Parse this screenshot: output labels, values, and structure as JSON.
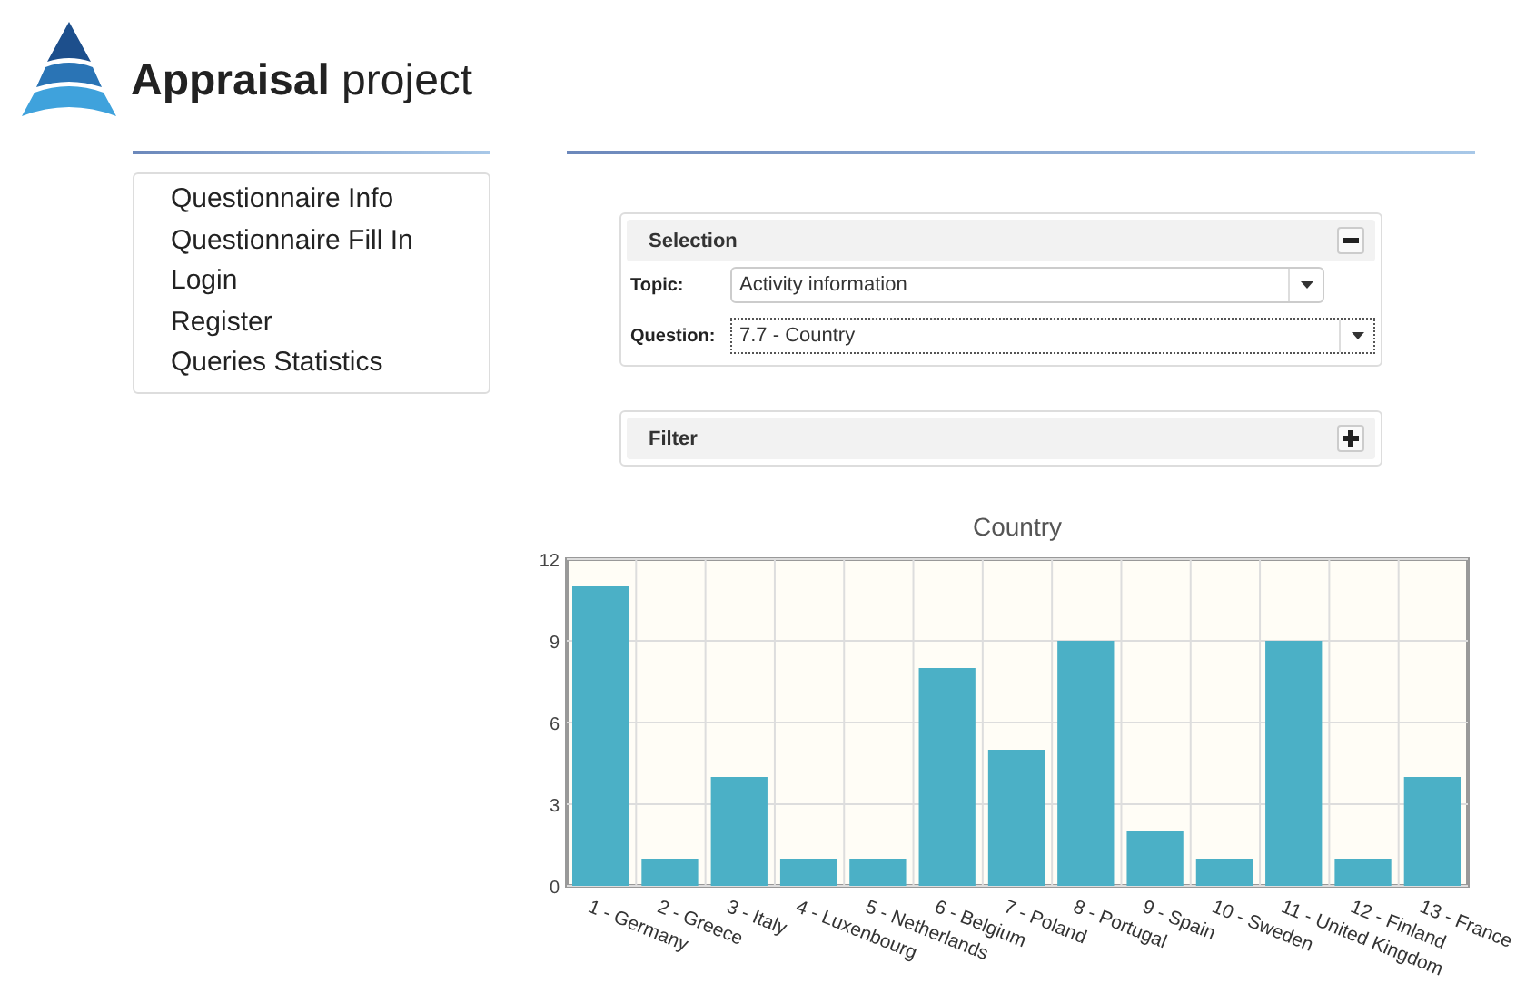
{
  "brand": {
    "bold": "Appraisal",
    "light": "project"
  },
  "nav": [
    "Questionnaire Info",
    "Questionnaire Fill In",
    "Login",
    "Register",
    "Queries Statistics"
  ],
  "selection": {
    "title": "Selection",
    "expanded": true,
    "fields": [
      {
        "label": "Topic:",
        "value": "Activity information",
        "focused": false
      },
      {
        "label": "Question:",
        "value": "7.7 - Country",
        "focused": true
      }
    ]
  },
  "filter": {
    "title": "Filter",
    "expanded": false
  },
  "chart": {
    "chart_data": {
      "type": "bar",
      "title": "Country",
      "categories": [
        "1 - Germany",
        "2 - Greece",
        "3 - Italy",
        "4 - Luxenbourg",
        "5 - Netherlands",
        "6 - Belgium",
        "7 - Poland",
        "8 - Portugal",
        "9 - Spain",
        "10 - Sweden",
        "11 - United Kingdom",
        "12 - Finland",
        "13 - France"
      ],
      "series": [
        {
          "color": "#4bb0c6",
          "values": [
            11,
            1,
            4,
            1,
            1,
            8,
            5,
            9,
            2,
            1,
            9,
            1,
            4
          ]
        }
      ],
      "grid": true,
      "ylim": [
        0,
        12
      ],
      "yticks": [
        0,
        3,
        6,
        9,
        12
      ]
    }
  }
}
